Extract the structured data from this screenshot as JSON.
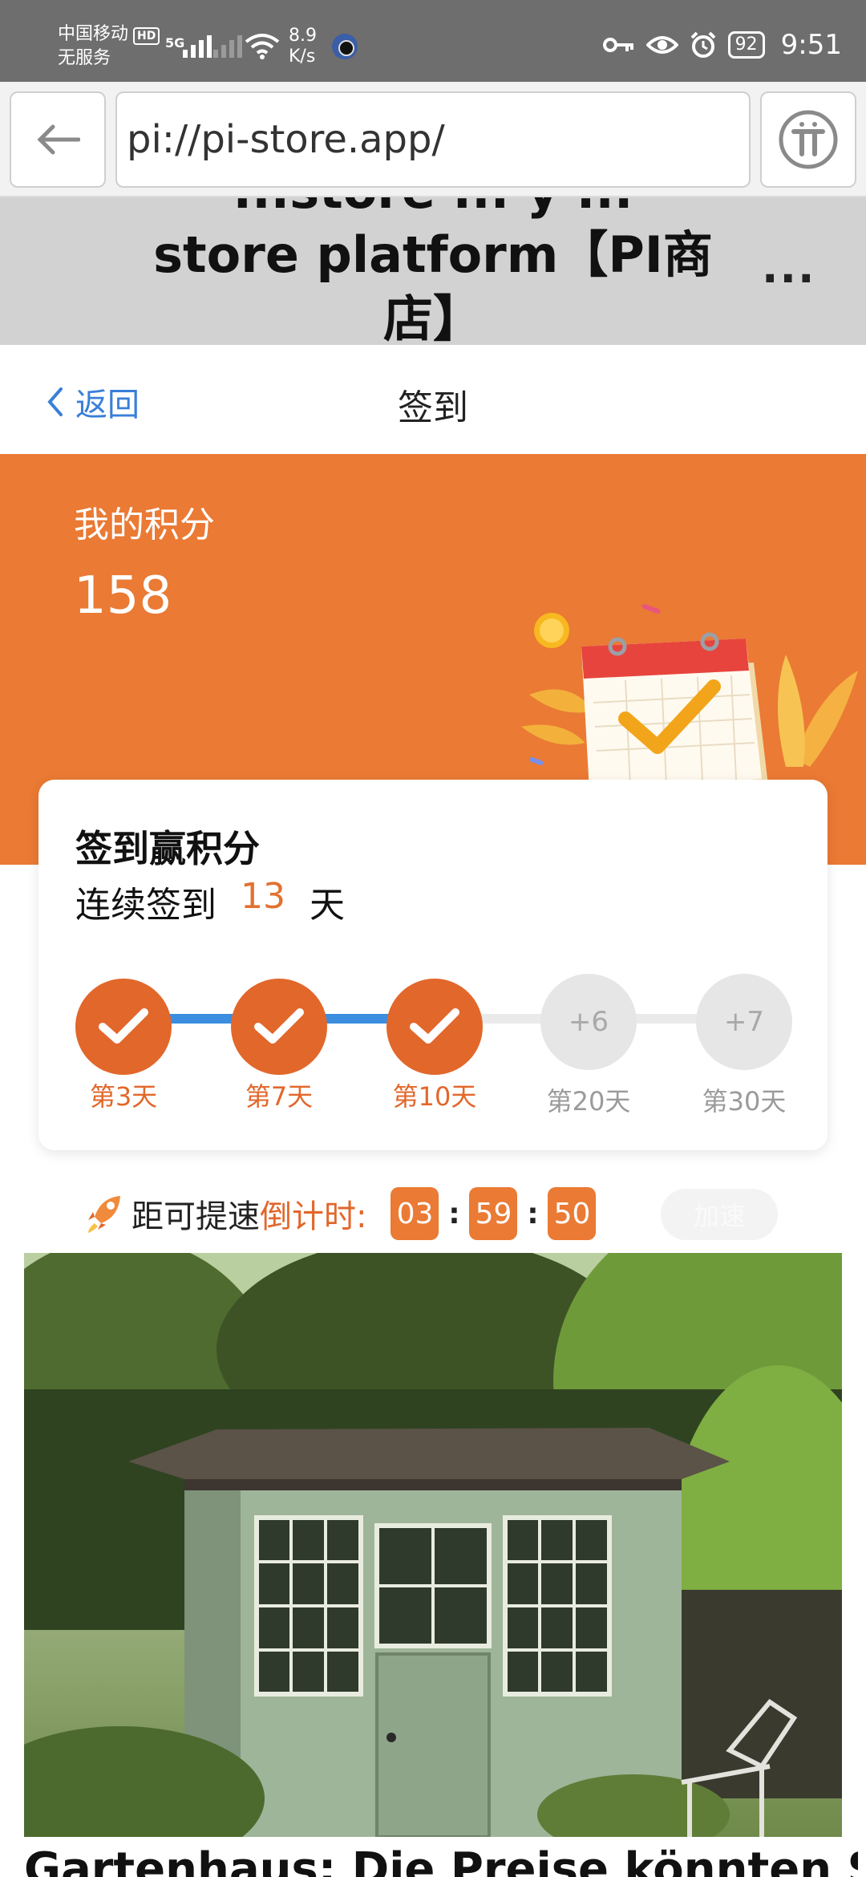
{
  "status_bar": {
    "carrier_line1": "中国移动",
    "carrier_line2": "无服务",
    "hd": "HD",
    "network": "5G",
    "speed_value": "8.9",
    "speed_unit": "K/s",
    "battery": "92",
    "time": "9:51"
  },
  "browser": {
    "url": "pi://pi-store.app/"
  },
  "page_header": {
    "title_ghost": "...store ... y ...",
    "title": "store platform【PI商",
    "title_tail": "店】",
    "more": "···"
  },
  "nav": {
    "back_label": "返回",
    "title": "签到"
  },
  "points": {
    "label": "我的积分",
    "value": "158"
  },
  "checkin": {
    "heading": "签到赢积分",
    "streak_prefix": "连续签到",
    "streak_days": "13",
    "streak_suffix": "天",
    "progress_fraction": 0.43,
    "milestones": [
      {
        "label": "第3天",
        "done": true,
        "bonus": ""
      },
      {
        "label": "第7天",
        "done": true,
        "bonus": ""
      },
      {
        "label": "第10天",
        "done": true,
        "bonus": ""
      },
      {
        "label": "第20天",
        "done": false,
        "bonus": "+6"
      },
      {
        "label": "第30天",
        "done": false,
        "bonus": "+7"
      }
    ]
  },
  "countdown": {
    "label": "距可提速",
    "accent_label": "倒计时:",
    "hours": "03",
    "minutes": "59",
    "seconds": "50",
    "speedup_button": "加速"
  },
  "article": {
    "caption": "Gartenhaus: Die Preise könnten Sie"
  },
  "colors": {
    "accent_orange": "#ea7a34",
    "progress_blue": "#3b8de0",
    "link_blue": "#3a7fd8"
  }
}
